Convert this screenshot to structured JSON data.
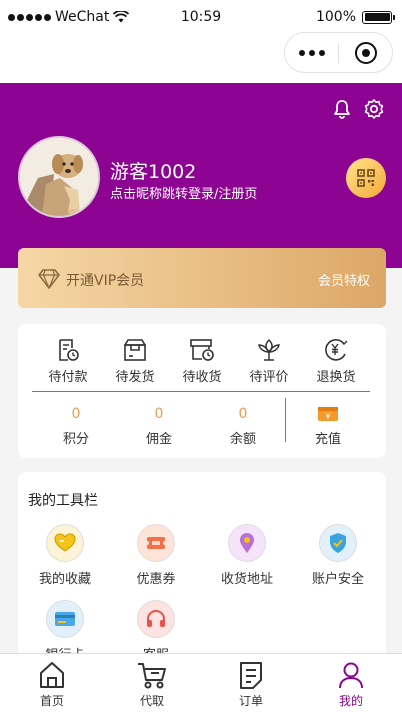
{
  "status_bar": {
    "carrier": "WeChat",
    "time": "10:59",
    "battery": "100%"
  },
  "profile": {
    "username": "游客1002",
    "login_hint": "点击昵称跳转登录/注册页"
  },
  "vip": {
    "title": "开通VIP会员",
    "privilege": "会员特权"
  },
  "orders": [
    {
      "label": "待付款",
      "icon": "pending-payment-icon"
    },
    {
      "label": "待发货",
      "icon": "pending-shipment-icon"
    },
    {
      "label": "待收货",
      "icon": "pending-receipt-icon"
    },
    {
      "label": "待评价",
      "icon": "pending-review-icon"
    },
    {
      "label": "退换货",
      "icon": "refund-icon"
    }
  ],
  "assets": [
    {
      "value": "0",
      "label": "积分"
    },
    {
      "value": "0",
      "label": "佣金"
    },
    {
      "value": "0",
      "label": "余额"
    }
  ],
  "recharge": {
    "label": "充值",
    "icon": "recharge-icon"
  },
  "tools": {
    "title": "我的工具栏",
    "items": [
      {
        "label": "我的收藏",
        "icon": "favorites-heart-icon",
        "color": "#f5c418"
      },
      {
        "label": "优惠券",
        "icon": "coupon-icon",
        "color": "#f0704a"
      },
      {
        "label": "收货地址",
        "icon": "location-pin-icon",
        "color": "#b86fd6"
      },
      {
        "label": "账户安全",
        "icon": "shield-check-icon",
        "color": "#3aa3e0"
      },
      {
        "label": "银行卡",
        "icon": "bank-card-icon",
        "color": "#4aa8e8"
      },
      {
        "label": "客服",
        "icon": "headset-icon",
        "color": "#e8524a"
      }
    ]
  },
  "tabbar": [
    {
      "label": "首页",
      "icon": "home-icon"
    },
    {
      "label": "代取",
      "icon": "delivery-cart-icon"
    },
    {
      "label": "订单",
      "icon": "order-list-icon"
    },
    {
      "label": "我的",
      "icon": "user-profile-icon",
      "active": true
    }
  ],
  "colors": {
    "brand": "#8c0491",
    "accent_orange": "#f19a50",
    "divider_teal": "#17a2a8"
  }
}
